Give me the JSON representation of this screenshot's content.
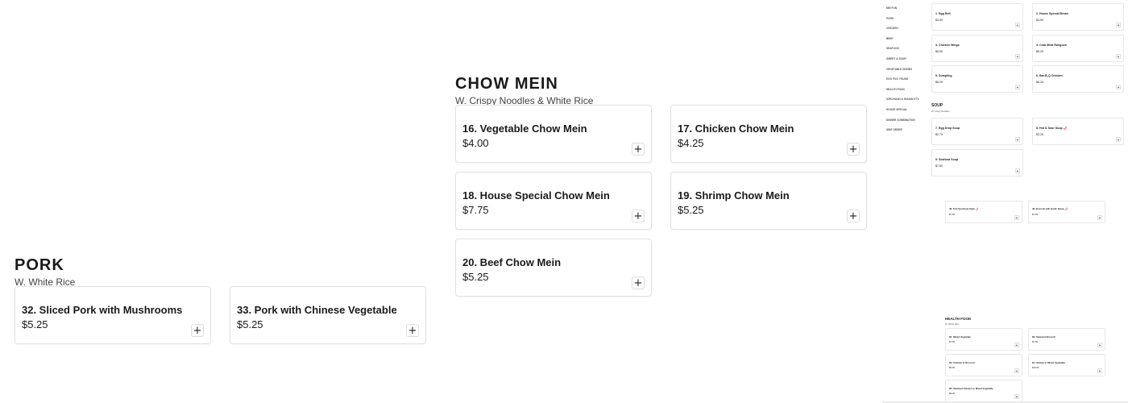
{
  "chow_mein": {
    "title": "CHOW MEIN",
    "subtitle": "W. Crispy Noodles & White Rice",
    "items": [
      {
        "name": "16. Vegetable Chow Mein",
        "price": "$4.00"
      },
      {
        "name": "17. Chicken Chow Mein",
        "price": "$4.25"
      },
      {
        "name": "18. House Special Chow Mein",
        "price": "$7.75"
      },
      {
        "name": "19. Shrimp Chow Mein",
        "price": "$5.25"
      },
      {
        "name": "20. Beef Chow Mein",
        "price": "$5.25"
      }
    ]
  },
  "pork": {
    "title": "PORK",
    "subtitle": "W. White Rice",
    "items": [
      {
        "name": "32. Sliced Pork with Mushrooms",
        "price": "$5.25"
      },
      {
        "name": "33. Pork with Chinese Vegetable",
        "price": "$5.25"
      }
    ]
  },
  "add_button_label": "+",
  "preview": {
    "nav": [
      "MEI FUN",
      "PORK",
      "CHICKEN",
      "BEEF",
      "SEAFOOD",
      "SWEET & SOUR",
      "VEGETABLE DISHES",
      "EGG FOO YOUNG",
      "HEALTH FOOD",
      "SZECHUAN & HUNAN STY.",
      "HOUSE SPECIAL",
      "DINNER COMBINATION",
      "SIDE ORDER"
    ],
    "appetizers": [
      {
        "name": "1. Egg Roll",
        "price": "$3.00"
      },
      {
        "name": "2. House Special Bread",
        "price": "$4.50"
      },
      {
        "name": "3. Chicken Wings",
        "price": "$6.50"
      },
      {
        "name": "4. Crab Meat Rangoon",
        "price": "$5.25"
      },
      {
        "name": "5. Dumpling",
        "price": "$6.25"
      },
      {
        "name": "6. Bar-B-Q Chicken",
        "price": "$6.25"
      }
    ],
    "soup_title": "SOUP",
    "soup_subtitle": "W. crispy Noodles",
    "soup": [
      {
        "name": "7. Egg Drop Soup",
        "price": "$2.75"
      },
      {
        "name": "8. Hot & Sour Soup",
        "price": "$3.25",
        "spicy": "🌶"
      },
      {
        "name": "9. Seafood Soup",
        "price": "$7.50"
      }
    ],
    "vegetable": [
      {
        "name": "48. Tofu Szechuan Style",
        "price": "$7.50",
        "spicy": "🌶"
      },
      {
        "name": "49. Broccoli with Garlic Sauce",
        "price": "$7.50",
        "spicy": "🌶"
      }
    ],
    "health_title": "HEALTH FOOD",
    "health_subtitle": "W. White Rice",
    "health": [
      {
        "name": "D1. Mixed Vegetable",
        "price": "$7.50"
      },
      {
        "name": "D2. Steamed Broccoli",
        "price": "$7.50"
      },
      {
        "name": "D3. Chicken w. Broccoli",
        "price": "$9.50"
      },
      {
        "name": "D4. Shrimp w. Mixed Vegetable",
        "price": "$10.50"
      },
      {
        "name": "D5. Steamed Chicken w. Mixed Vegetable",
        "price": "$9.25"
      }
    ]
  }
}
